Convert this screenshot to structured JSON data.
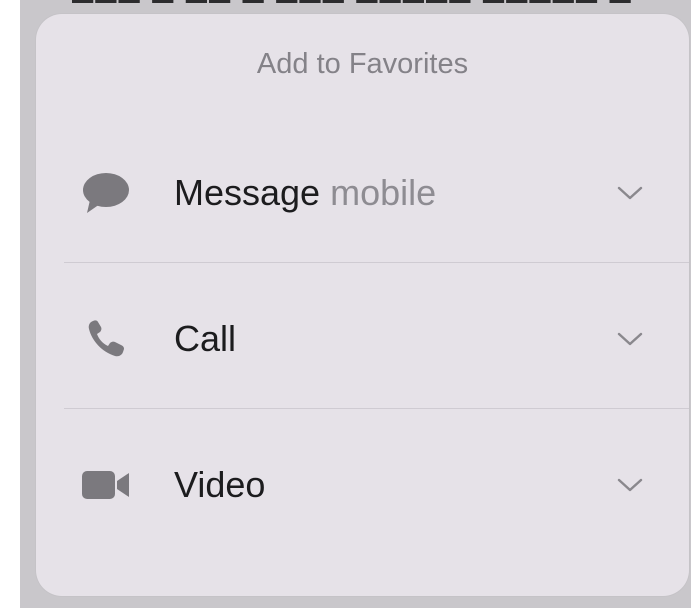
{
  "sheet": {
    "title": "Add to Favorites",
    "rows": [
      {
        "icon": "message-bubble-icon",
        "label": "Message",
        "sublabel": "mobile"
      },
      {
        "icon": "phone-icon",
        "label": "Call",
        "sublabel": ""
      },
      {
        "icon": "video-camera-icon",
        "label": "Video",
        "sublabel": ""
      }
    ]
  },
  "colors": {
    "sheet_background": "#e6e2e8",
    "backdrop": "#c9c7cb",
    "icon_gray": "#7b797e",
    "title_gray": "#848288",
    "label_text": "#1c1c1e"
  }
}
